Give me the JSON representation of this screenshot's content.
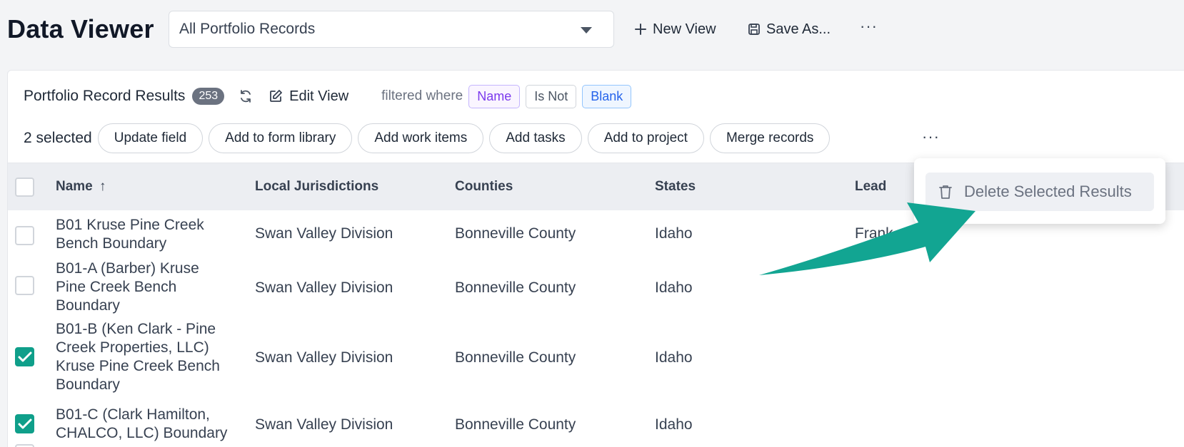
{
  "header": {
    "title": "Data Viewer",
    "view_selector": "All Portfolio Records",
    "new_view": "New View",
    "save_as": "Save As...",
    "more": "···"
  },
  "results": {
    "title": "Portfolio Record Results",
    "count": "253",
    "edit_view": "Edit View",
    "filter_prefix": "filtered where",
    "filter": {
      "field": "Name",
      "operator": "Is Not",
      "value": "Blank"
    }
  },
  "bulk": {
    "selected_label": "2 selected",
    "actions": [
      "Update field",
      "Add to form library",
      "Add work items",
      "Add tasks",
      "Add to project",
      "Merge records"
    ],
    "more": "···"
  },
  "table": {
    "columns": [
      "Name",
      "Local Jurisdictions",
      "Counties",
      "States",
      "Lead"
    ],
    "sort_indicator": "↑",
    "rows": [
      {
        "name": "B01 Kruse Pine Creek Bench Boundary",
        "jurisdiction": "Swan Valley Division",
        "county": "Bonneville County",
        "state": "Idaho",
        "lead": "Frank",
        "checked": false
      },
      {
        "name": "B01-A (Barber) Kruse Pine Creek Bench Boundary",
        "jurisdiction": "Swan Valley Division",
        "county": "Bonneville County",
        "state": "Idaho",
        "lead": "",
        "checked": false
      },
      {
        "name": "B01-B (Ken Clark - Pine Creek Properties, LLC) Kruse Pine Creek Bench Boundary",
        "jurisdiction": "Swan Valley Division",
        "county": "Bonneville County",
        "state": "Idaho",
        "lead": "",
        "checked": true
      },
      {
        "name": "B01-C (Clark Hamilton, CHALCO, LLC) Boundary",
        "jurisdiction": "Swan Valley Division",
        "county": "Bonneville County",
        "state": "Idaho",
        "lead": "",
        "checked": true
      }
    ]
  },
  "menu": {
    "delete_label": "Delete Selected Results"
  },
  "colors": {
    "accent": "#0f9f8a",
    "arrow": "#12a592",
    "badge": "#6b7280"
  }
}
